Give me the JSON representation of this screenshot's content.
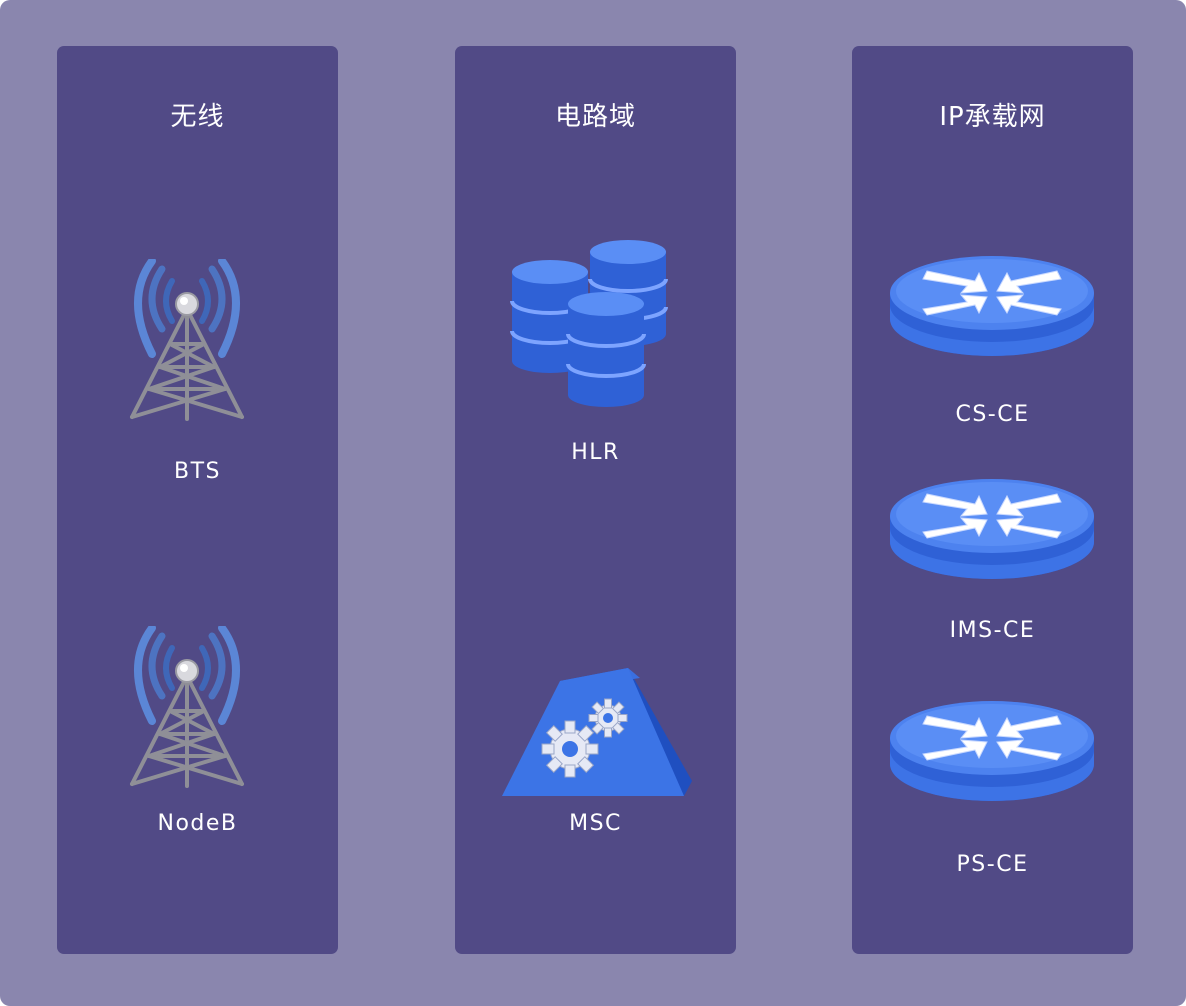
{
  "columns": [
    {
      "title": "无线",
      "items": [
        {
          "label": "BTS",
          "icon": "antenna-tower-icon"
        },
        {
          "label": "NodeB",
          "icon": "antenna-tower-icon"
        }
      ]
    },
    {
      "title": "电路域",
      "items": [
        {
          "label": "HLR",
          "icon": "database-icon"
        },
        {
          "label": "MSC",
          "icon": "gear-switch-icon"
        }
      ]
    },
    {
      "title": "IP承载网",
      "items": [
        {
          "label": "CS-CE",
          "icon": "router-icon"
        },
        {
          "label": "IMS-CE",
          "icon": "router-icon"
        },
        {
          "label": "PS-CE",
          "icon": "router-icon"
        }
      ]
    }
  ],
  "colors": {
    "background": "#8a86ae",
    "panel": "#514a86",
    "device_blue": "#2f61d6",
    "text": "#ffffff"
  }
}
